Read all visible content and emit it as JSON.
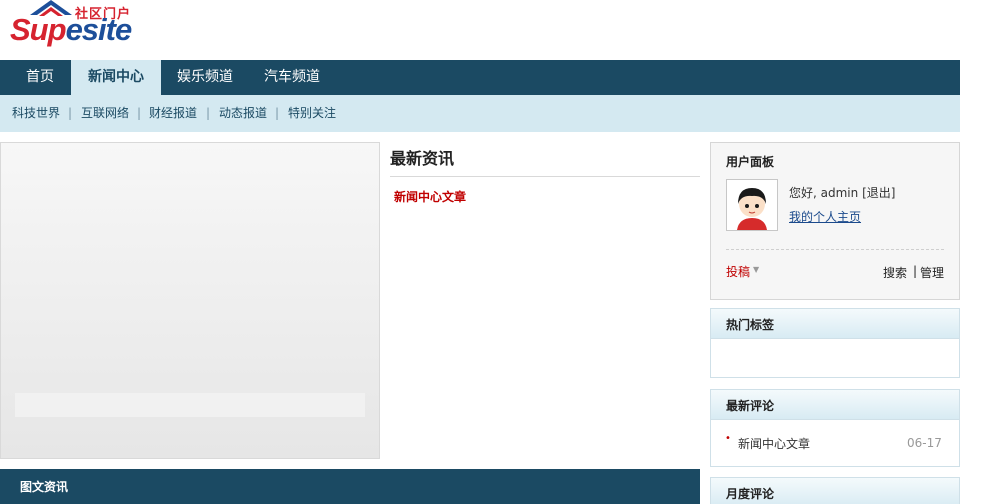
{
  "logo": {
    "tagline": "社区门户",
    "word_part1": "Sup",
    "word_part2": "esite"
  },
  "nav": {
    "items": [
      "首页",
      "新闻中心",
      "娱乐频道",
      "汽车频道"
    ],
    "active_index": 1
  },
  "subnav": {
    "items": [
      "科技世界",
      "互联网络",
      "财经报道",
      "动态报道",
      "特别关注"
    ],
    "separator": "|"
  },
  "latest_news": {
    "title": "最新资讯",
    "link": "新闻中心文章"
  },
  "image_news": {
    "title": "图文资讯"
  },
  "user_panel": {
    "title": "用户面板",
    "greeting": "您好, admin",
    "logout": "[退出]",
    "homepage_link": "我的个人主页",
    "submit": "投稿",
    "search": "搜索",
    "separator": "|",
    "manage": "管理"
  },
  "hot_tags": {
    "title": "热门标签"
  },
  "latest_comments": {
    "title": "最新评论",
    "items": [
      {
        "text": "新闻中心文章",
        "date": "06-17"
      }
    ]
  },
  "monthly_comments": {
    "title": "月度评论"
  },
  "colors": {
    "nav_bg": "#1b4a63",
    "subnav_bg": "#d4e9f1",
    "accent_red": "#c00000",
    "logo_red": "#d6232f",
    "logo_blue": "#1d4f9a"
  },
  "icons": {
    "logo_mark": "house-roof-icon",
    "dropdown": "triangle-down-icon",
    "bullet": "dot-icon",
    "avatar": "user-avatar-icon"
  }
}
